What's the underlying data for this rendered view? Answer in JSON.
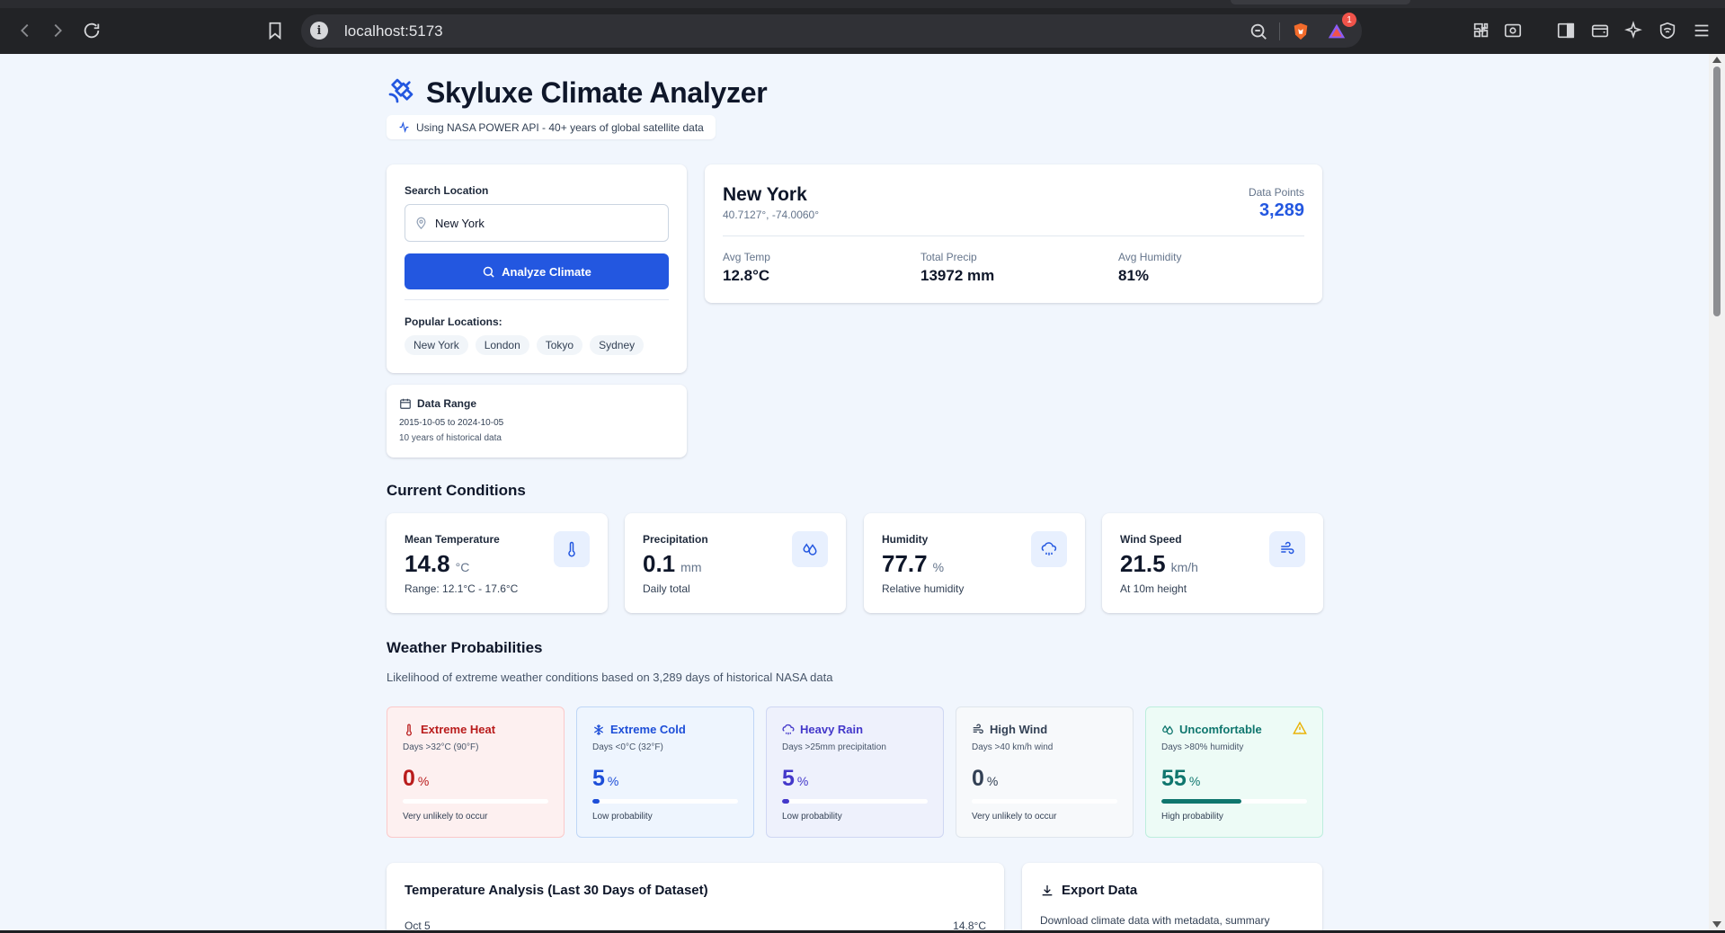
{
  "browser": {
    "url": "localhost:5173",
    "notification_count": "1"
  },
  "app": {
    "title": "Skyluxe Climate Analyzer",
    "subtitle": "Using NASA POWER API - 40+ years of global satellite data",
    "accent": "#2357e0"
  },
  "search": {
    "label": "Search Location",
    "value": "New York",
    "button_label": "Analyze Climate",
    "popular_label": "Popular Locations:",
    "popular": [
      "New York",
      "London",
      "Tokyo",
      "Sydney"
    ]
  },
  "data_range": {
    "title": "Data Range",
    "range": "2015-10-05 to 2024-10-05",
    "note": "10 years of historical data"
  },
  "location": {
    "name": "New York",
    "coords": "40.7127°, -74.0060°",
    "data_points_label": "Data Points",
    "data_points": "3,289",
    "stats": [
      {
        "label": "Avg Temp",
        "value": "12.8°C"
      },
      {
        "label": "Total Precip",
        "value": "13972 mm"
      },
      {
        "label": "Avg Humidity",
        "value": "81%"
      }
    ]
  },
  "current": {
    "heading": "Current Conditions",
    "cards": [
      {
        "label": "Mean Temperature",
        "value": "14.8",
        "unit": "°C",
        "sub": "Range: 12.1°C - 17.6°C",
        "icon": "thermometer-icon"
      },
      {
        "label": "Precipitation",
        "value": "0.1",
        "unit": "mm",
        "sub": "Daily total",
        "icon": "droplets-icon"
      },
      {
        "label": "Humidity",
        "value": "77.7",
        "unit": "%",
        "sub": "Relative humidity",
        "icon": "cloud-rain-icon"
      },
      {
        "label": "Wind Speed",
        "value": "21.5",
        "unit": "km/h",
        "sub": "At 10m height",
        "icon": "wind-icon"
      }
    ]
  },
  "probabilities": {
    "heading": "Weather Probabilities",
    "description": "Likelihood of extreme weather conditions based on 3,289 days of historical NASA data",
    "cards": [
      {
        "title": "Extreme Heat",
        "sub": "Days >32°C (90°F)",
        "value": "0",
        "unit": "%",
        "percent": 0,
        "note": "Very unlikely to occur",
        "color": "#b91c1c",
        "bg": "#fdf0f0",
        "border": "#fbc9c9",
        "icon": "thermometer-icon"
      },
      {
        "title": "Extreme Cold",
        "sub": "Days <0°C (32°F)",
        "value": "5",
        "unit": "%",
        "percent": 5,
        "note": "Low probability",
        "color": "#1d4ed8",
        "bg": "#eef5fe",
        "border": "#bfd6f6",
        "icon": "snowflake-icon"
      },
      {
        "title": "Heavy Rain",
        "sub": "Days >25mm precipitation",
        "value": "5",
        "unit": "%",
        "percent": 5,
        "note": "Low probability",
        "color": "#4338ca",
        "bg": "#eef1fc",
        "border": "#cfd7f3",
        "icon": "cloud-rain-icon"
      },
      {
        "title": "High Wind",
        "sub": "Days >40 km/h wind",
        "value": "0",
        "unit": "%",
        "percent": 0,
        "note": "Very unlikely to occur",
        "color": "#334155",
        "bg": "#f7f9fb",
        "border": "#dfe5ec",
        "icon": "wind-icon"
      },
      {
        "title": "Uncomfortable",
        "sub": "Days >80% humidity",
        "value": "55",
        "unit": "%",
        "percent": 55,
        "note": "High probability",
        "color": "#0f766e",
        "bg": "#edfbf6",
        "border": "#bdeedd",
        "icon": "droplets-icon"
      }
    ]
  },
  "temperature_analysis": {
    "title": "Temperature Analysis (Last 30 Days of Dataset)",
    "first_label": "Oct 5",
    "first_value": "14.8°C"
  },
  "export": {
    "title": "Export Data",
    "description": "Download climate data with metadata, summary"
  }
}
